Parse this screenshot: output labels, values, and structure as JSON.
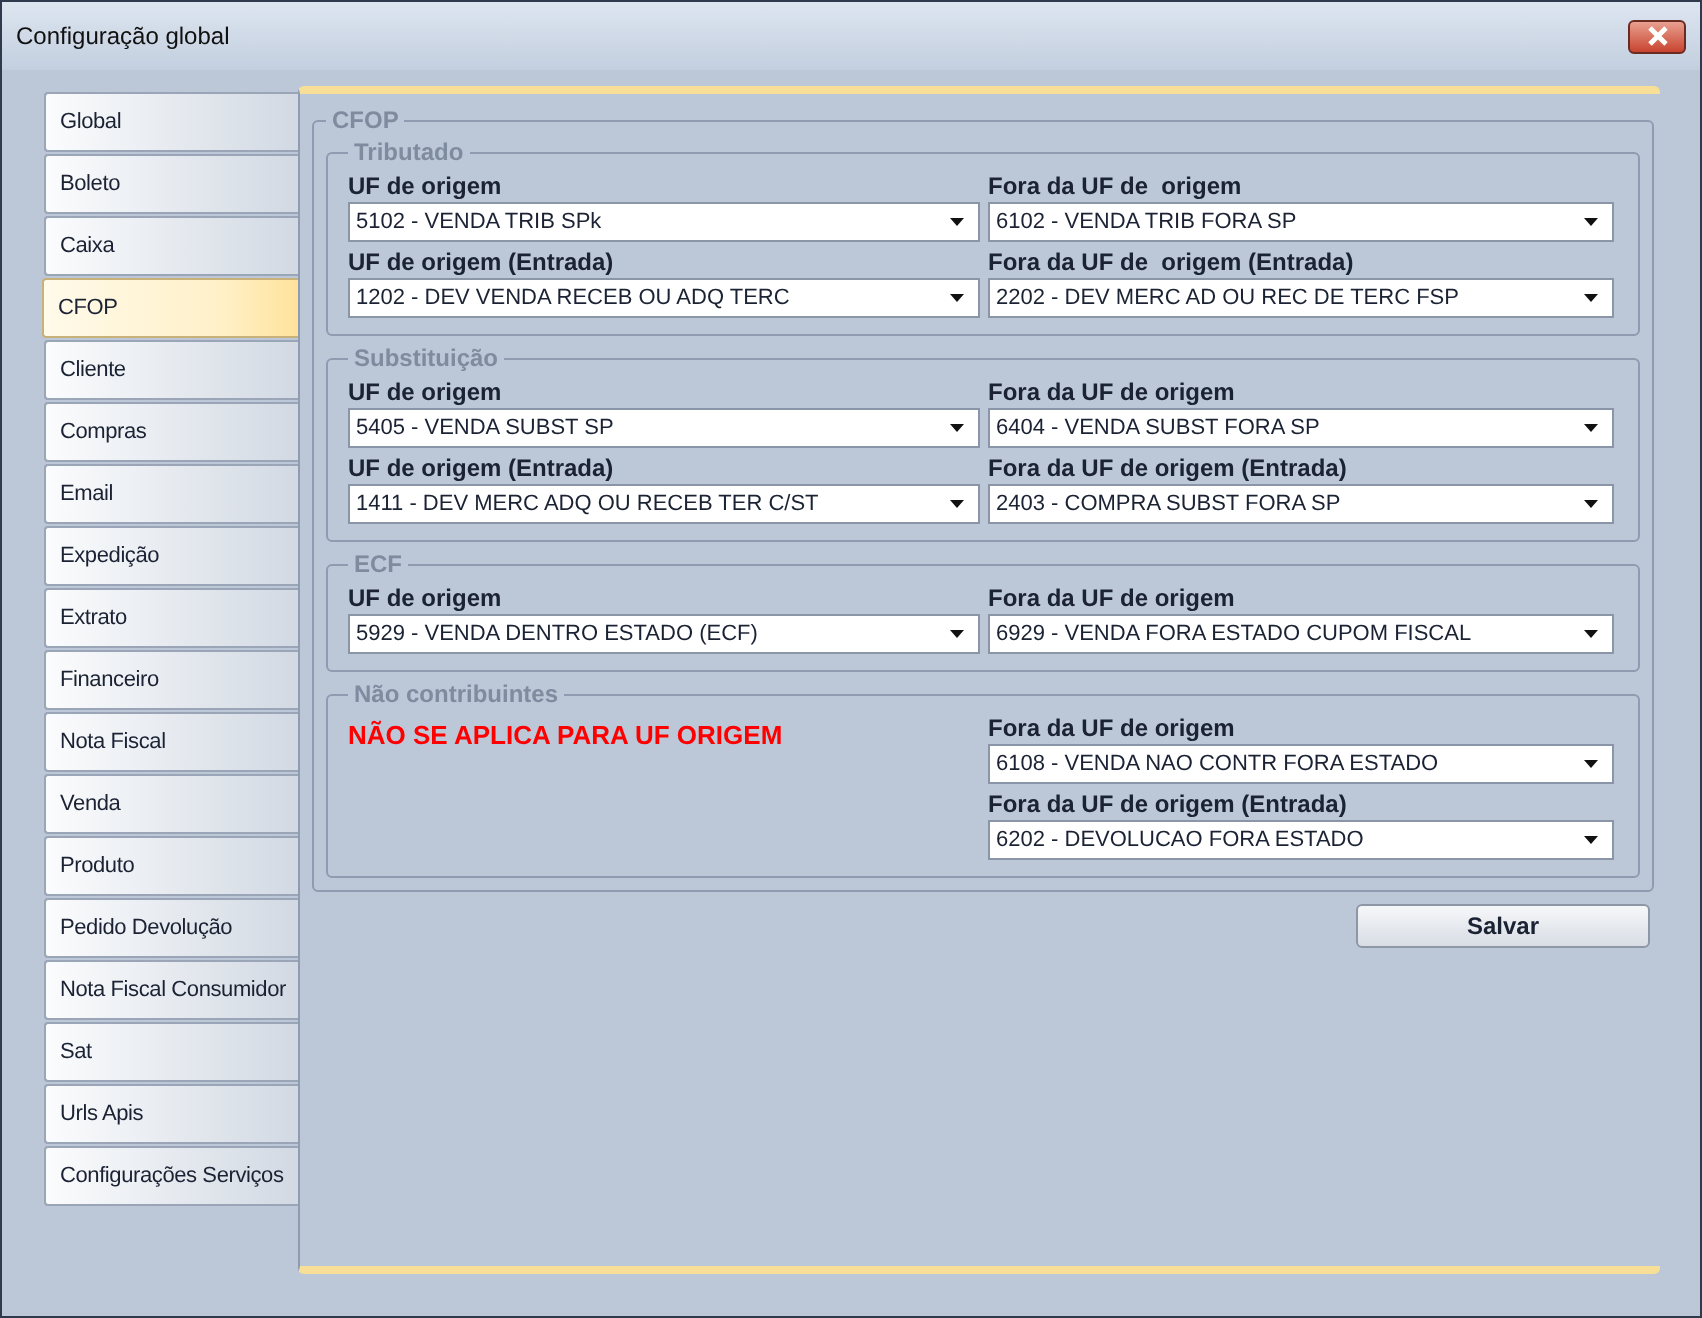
{
  "window": {
    "title": "Configuração global"
  },
  "sidebar": {
    "items": [
      {
        "label": "Global",
        "selected": false
      },
      {
        "label": "Boleto",
        "selected": false
      },
      {
        "label": "Caixa",
        "selected": false
      },
      {
        "label": "CFOP",
        "selected": true
      },
      {
        "label": "Cliente",
        "selected": false
      },
      {
        "label": "Compras",
        "selected": false
      },
      {
        "label": "Email",
        "selected": false
      },
      {
        "label": "Expedição",
        "selected": false
      },
      {
        "label": "Extrato",
        "selected": false
      },
      {
        "label": "Financeiro",
        "selected": false
      },
      {
        "label": "Nota Fiscal",
        "selected": false
      },
      {
        "label": "Venda",
        "selected": false
      },
      {
        "label": "Produto",
        "selected": false
      },
      {
        "label": "Pedido Devolução",
        "selected": false
      },
      {
        "label": "Nota Fiscal Consumidor",
        "selected": false
      },
      {
        "label": "Sat",
        "selected": false
      },
      {
        "label": "Urls Apis",
        "selected": false
      },
      {
        "label": "Configurações Serviços",
        "selected": false
      }
    ]
  },
  "section": {
    "title": "CFOP",
    "groups": [
      {
        "title": "Tributado",
        "rows": [
          {
            "left": {
              "label": "UF de origem",
              "value": "5102 - VENDA TRIB SPk"
            },
            "right": {
              "label": "Fora da UF de  origem",
              "value": "6102 - VENDA TRIB FORA SP"
            }
          },
          {
            "left": {
              "label": "UF de origem (Entrada)",
              "value": "1202 - DEV VENDA RECEB OU ADQ TERC"
            },
            "right": {
              "label": "Fora da UF de  origem (Entrada)",
              "value": "2202 - DEV MERC AD OU REC DE TERC FSP"
            }
          }
        ]
      },
      {
        "title": "Substituição",
        "rows": [
          {
            "left": {
              "label": "UF de origem",
              "value": "5405 - VENDA SUBST SP"
            },
            "right": {
              "label": "Fora da UF de origem",
              "value": "6404 - VENDA SUBST FORA SP"
            }
          },
          {
            "left": {
              "label": "UF de origem (Entrada)",
              "value": "1411 - DEV MERC ADQ OU RECEB TER C/ST"
            },
            "right": {
              "label": "Fora da UF de origem (Entrada)",
              "value": "2403 - COMPRA SUBST FORA SP"
            }
          }
        ]
      },
      {
        "title": "ECF",
        "rows": [
          {
            "left": {
              "label": "UF de origem",
              "value": "5929 - VENDA DENTRO ESTADO (ECF)"
            },
            "right": {
              "label": "Fora da UF de origem",
              "value": "6929 - VENDA FORA ESTADO CUPOM FISCAL"
            }
          }
        ]
      },
      {
        "title": "Não contribuintes",
        "notice": "NÃO SE APLICA PARA UF ORIGEM",
        "rows": [
          {
            "right": {
              "label": "Fora da UF de origem",
              "value": "6108 - VENDA NAO CONTR FORA ESTADO"
            }
          },
          {
            "right": {
              "label": "Fora da UF de origem (Entrada)",
              "value": "6202 - DEVOLUCAO FORA ESTADO"
            }
          }
        ]
      }
    ]
  },
  "save_button": {
    "label": "Salvar"
  }
}
